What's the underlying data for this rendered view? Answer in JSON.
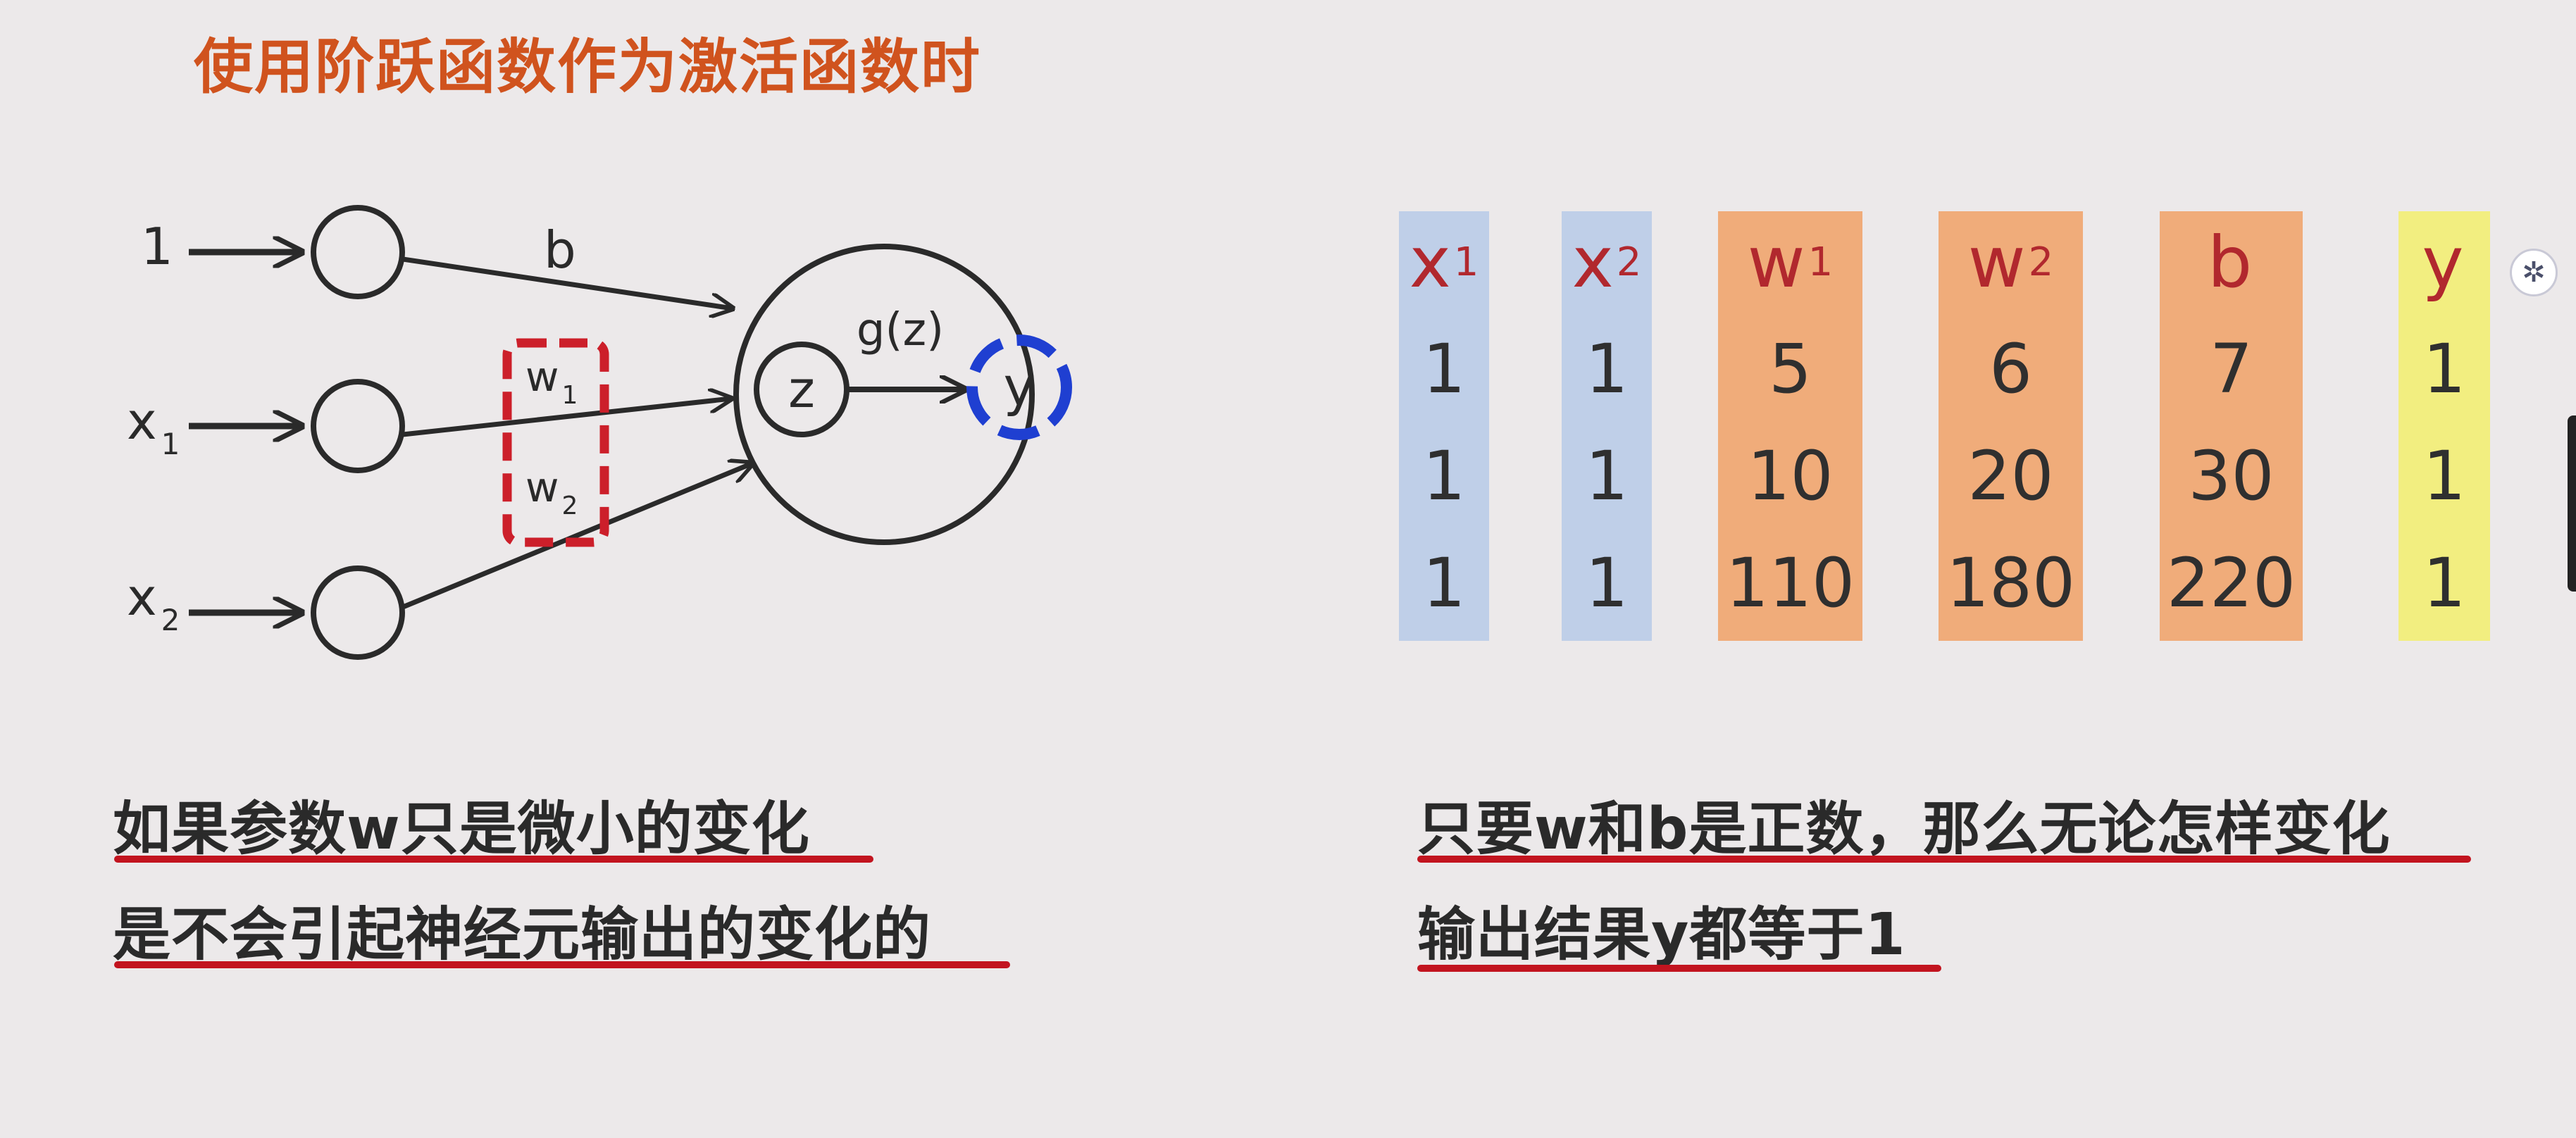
{
  "title": "使用阶跃函数作为激活函数时",
  "diagram": {
    "inputs": [
      "1",
      "x",
      "x"
    ],
    "input_subscripts": [
      "",
      "1",
      "2"
    ],
    "bias_label": "b",
    "weight_labels": [
      "w",
      "w"
    ],
    "weight_subscripts": [
      "1",
      "2"
    ],
    "z_label": "z",
    "activation_label": "g(z)",
    "output_label": "y",
    "colors": {
      "stroke": "#2a2a2a",
      "weight_box": "#cc1f2a",
      "output_ring": "#1f3fd1"
    }
  },
  "table": {
    "columns": [
      {
        "name": "x",
        "sub": "1",
        "color": "#bfcfe8",
        "values": [
          "1",
          "1",
          "1"
        ]
      },
      {
        "name": "x",
        "sub": "2",
        "color": "#bfcfe8",
        "values": [
          "1",
          "1",
          "1"
        ]
      },
      {
        "name": "w",
        "sub": "1",
        "color": "#f0ac7a",
        "values": [
          "5",
          "10",
          "110"
        ]
      },
      {
        "name": "w",
        "sub": "2",
        "color": "#f0ac7a",
        "values": [
          "6",
          "20",
          "180"
        ]
      },
      {
        "name": "b",
        "sub": "",
        "color": "#f0ac7a",
        "values": [
          "7",
          "30",
          "220"
        ]
      },
      {
        "name": "y",
        "sub": "",
        "color": "#f2ee80",
        "values": [
          "1",
          "1",
          "1"
        ]
      }
    ]
  },
  "notes_left": [
    "如果参数w只是微小的变化",
    "是不会引起神经元输出的变化的"
  ],
  "notes_right": [
    "只要w和b是正数，那么无论怎样变化",
    "输出结果y都等于1"
  ],
  "side_icon": "brain-icon"
}
